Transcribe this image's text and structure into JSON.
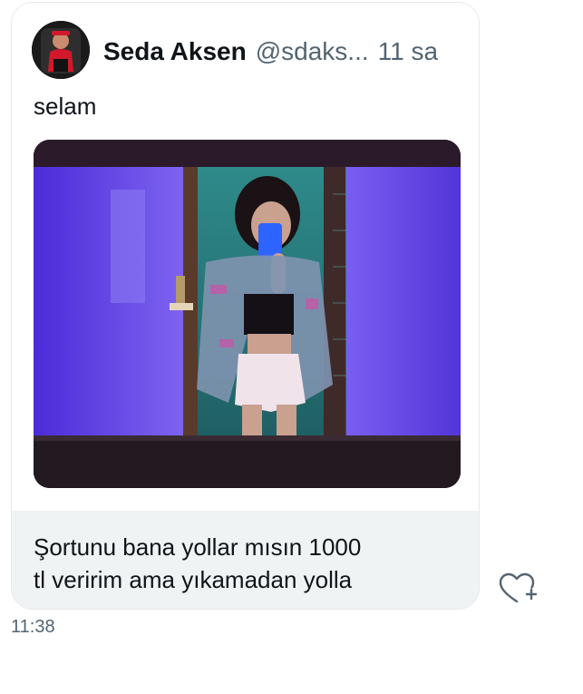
{
  "quoted_tweet": {
    "author_name": "Seda Aksen",
    "author_handle": "@sdaks...",
    "time": "11 sa",
    "text": "selam",
    "avatar_icon": "profile-avatar",
    "media_icon": "photo-mirror-selfie"
  },
  "message": {
    "text_line1": "Şortunu bana yollar mısın 1000",
    "text_line2": "tl veririm ama yıkamadan yolla",
    "timestamp": "11:38"
  },
  "react_button": {
    "icon": "heart-plus-icon"
  },
  "colors": {
    "text_primary": "#0f1419",
    "text_secondary": "#536471",
    "message_bg": "#eff3f4",
    "border": "#e6e9ec"
  }
}
